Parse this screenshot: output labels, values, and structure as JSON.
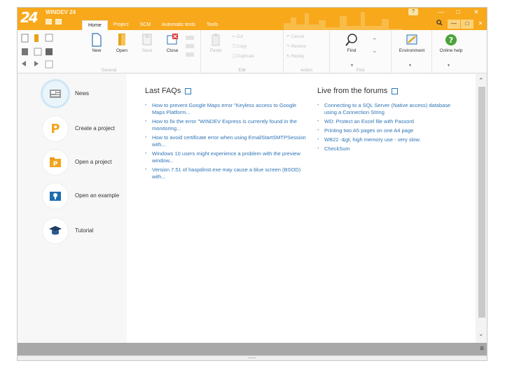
{
  "app": {
    "logo": "24",
    "title": "WINDEV 24"
  },
  "tabs": [
    "Home",
    "Project",
    "SCM",
    "Automatic tests",
    "Tools"
  ],
  "title_controls": {
    "help_badge": "?"
  },
  "ribbon": {
    "new_label": "New",
    "open_label": "Open",
    "save_label": "Save",
    "close_label": "Close",
    "paste_label": "Paste",
    "cut_label": "Cut",
    "copy_label": "Copy",
    "duplicate_label": "Duplicate",
    "cancel_label": "Cancel",
    "restore_label": "Restore",
    "replay_label": "Replay",
    "find_label": "Find",
    "environment_label": "Environment",
    "online_help_label": "Online help",
    "groups": {
      "general": "General",
      "edit": "Edit",
      "action": "Action",
      "find": "Find"
    }
  },
  "sidebar": {
    "items": [
      {
        "label": "News"
      },
      {
        "label": "Create a project"
      },
      {
        "label": "Open a project"
      },
      {
        "label": "Open an example"
      },
      {
        "label": "Tutorial"
      }
    ]
  },
  "faq": {
    "title": "Last FAQs",
    "items": [
      "How to prevent Google Maps error \"Keyless access to Google Maps Platform...",
      "How to fix the error \"WINDEV Express is currently found in the monitoring...",
      "How to avoid certificate error when using EmailStartSMTPSession with...",
      "Windows 10 users might experience a problem with the preview window...",
      "Version 7.51 of haspdinst.exe may cause a blue screen (BSOD) with..."
    ]
  },
  "forums": {
    "title": "Live from the forums",
    "items": [
      "Connecting to a SQL Server (Native access) database using a Connection String",
      "WD: Protect an Excel file with Passord",
      "Printing two A5 pages on one A4 page",
      "WB22 -&gt; high memory use - very slow.",
      "CheckSum"
    ]
  },
  "colors": {
    "titlebar": "#f7a81b",
    "link": "#2f74b5",
    "bottom_bar": "#a8a8a8"
  }
}
